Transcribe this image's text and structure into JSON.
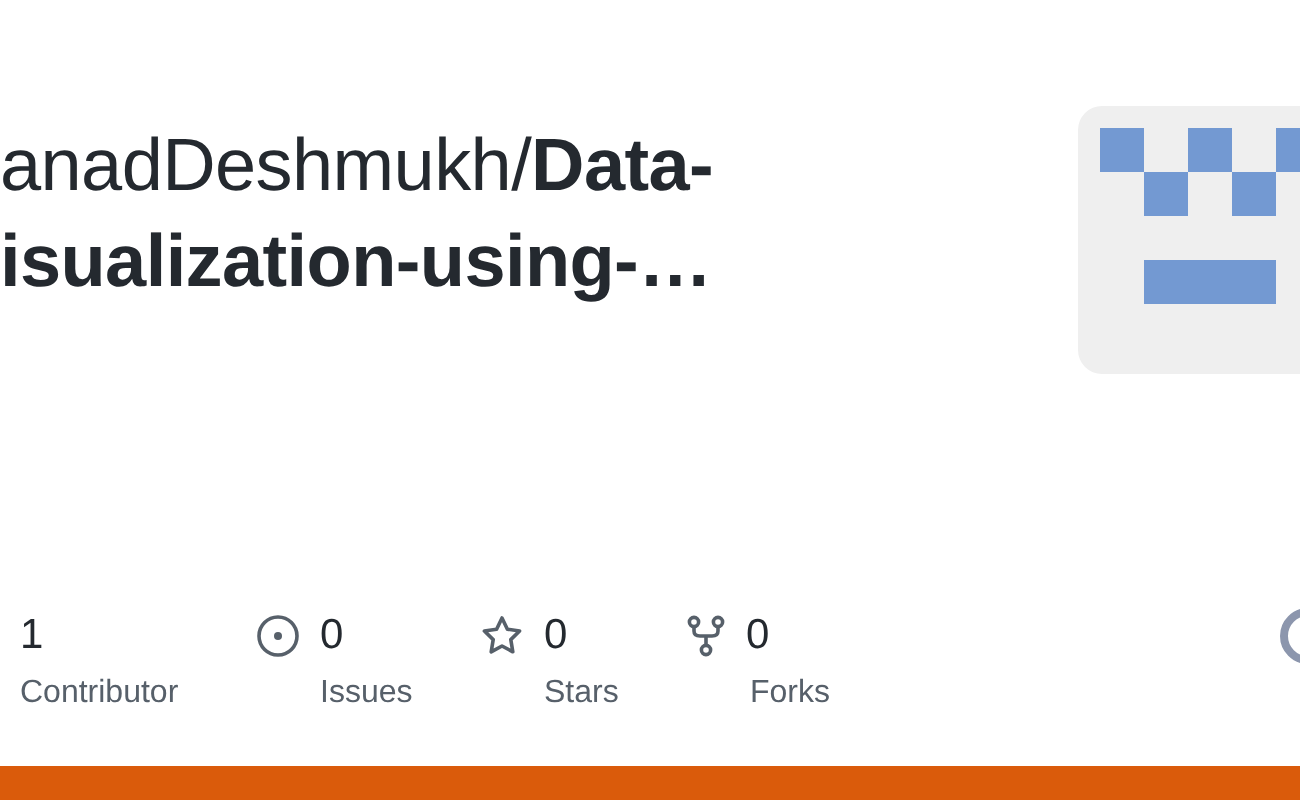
{
  "repo": {
    "owner": "anadDeshmukh/",
    "name_line_1": "Data-",
    "name_line_2": "isualization-using-…"
  },
  "stats": [
    {
      "kind": "contributors",
      "value": "1",
      "label": "Contributor"
    },
    {
      "kind": "issues",
      "value": "0",
      "label": "Issues"
    },
    {
      "kind": "stars",
      "value": "0",
      "label": "Stars"
    },
    {
      "kind": "forks",
      "value": "0",
      "label": "Forks"
    }
  ]
}
